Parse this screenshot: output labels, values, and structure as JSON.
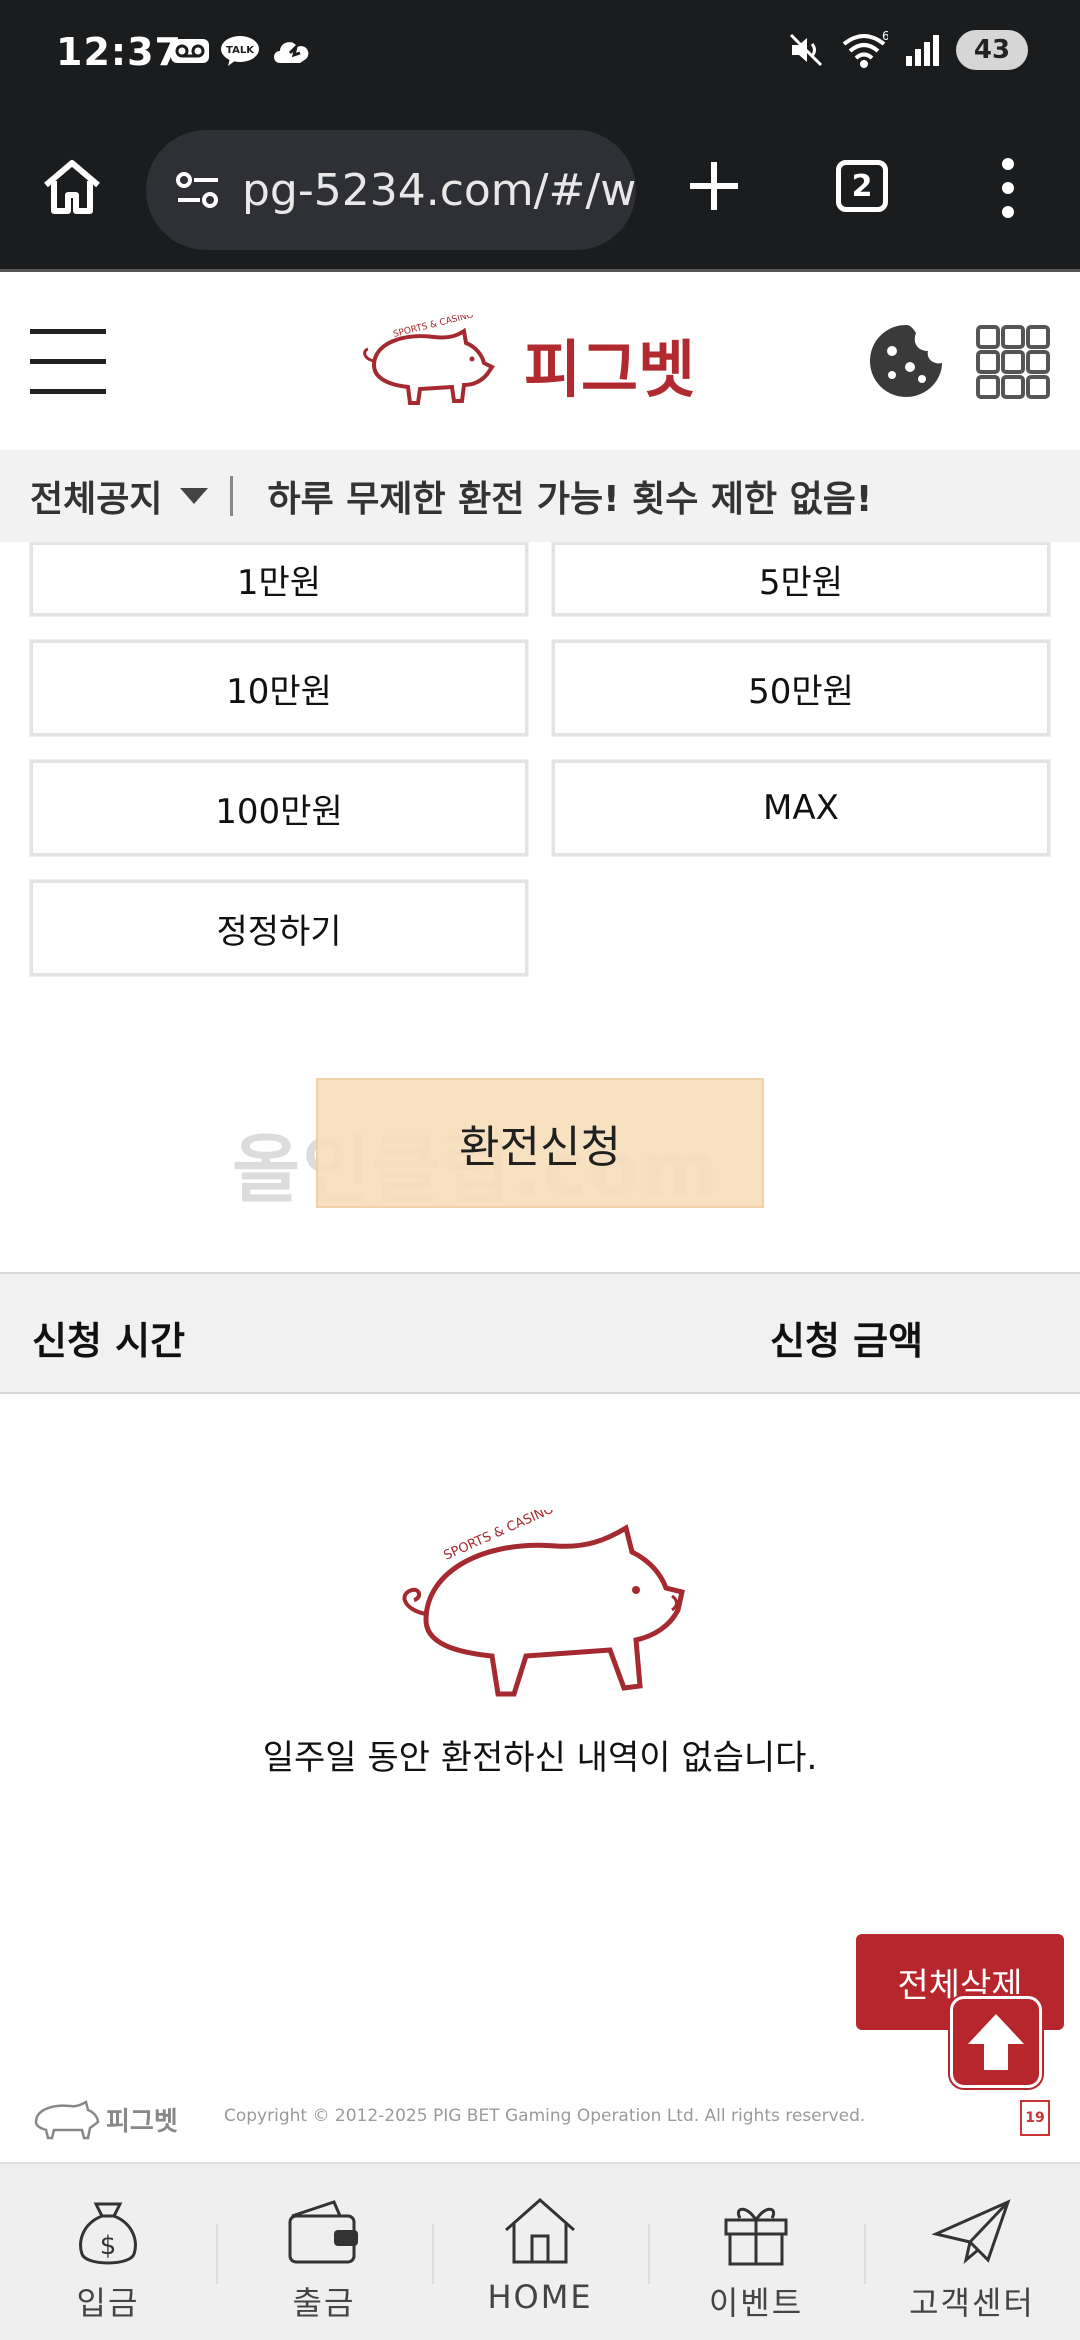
{
  "status_bar": {
    "time": "12:37",
    "battery": "43",
    "network": "6"
  },
  "browser": {
    "url": "pg-5234.com/#/w",
    "tab_count": "2"
  },
  "site": {
    "logo_text": "피그벳",
    "logo_tagline": "SPORTS & CASINO"
  },
  "notice": {
    "label": "전체공지",
    "text": "하루 무제한 환전 가능! 횟수 제한 없음!"
  },
  "amount_buttons": [
    "1만원",
    "5만원",
    "10만원",
    "50만원",
    "100만원",
    "MAX",
    "정정하기"
  ],
  "submit": {
    "label": "환전신청",
    "watermark": "올인클럽.com"
  },
  "history": {
    "columns": [
      "신청 시간",
      "신청 금액"
    ],
    "empty_message": "일주일 동안 환전하신 내역이 없습니다."
  },
  "actions": {
    "delete_all": "전체삭제"
  },
  "footer": {
    "copyright": "Copyright © 2012-2025 PIG BET Gaming Operation Ltd. All rights reserved.",
    "age_badge": "19"
  },
  "bottom_nav": [
    "입금",
    "출금",
    "HOME",
    "이벤트",
    "고객센터"
  ],
  "colors": {
    "brand_red": "#b7262c",
    "submit_bg": "#f7dfbd",
    "status_bar_bg": "#1b1c1e"
  }
}
